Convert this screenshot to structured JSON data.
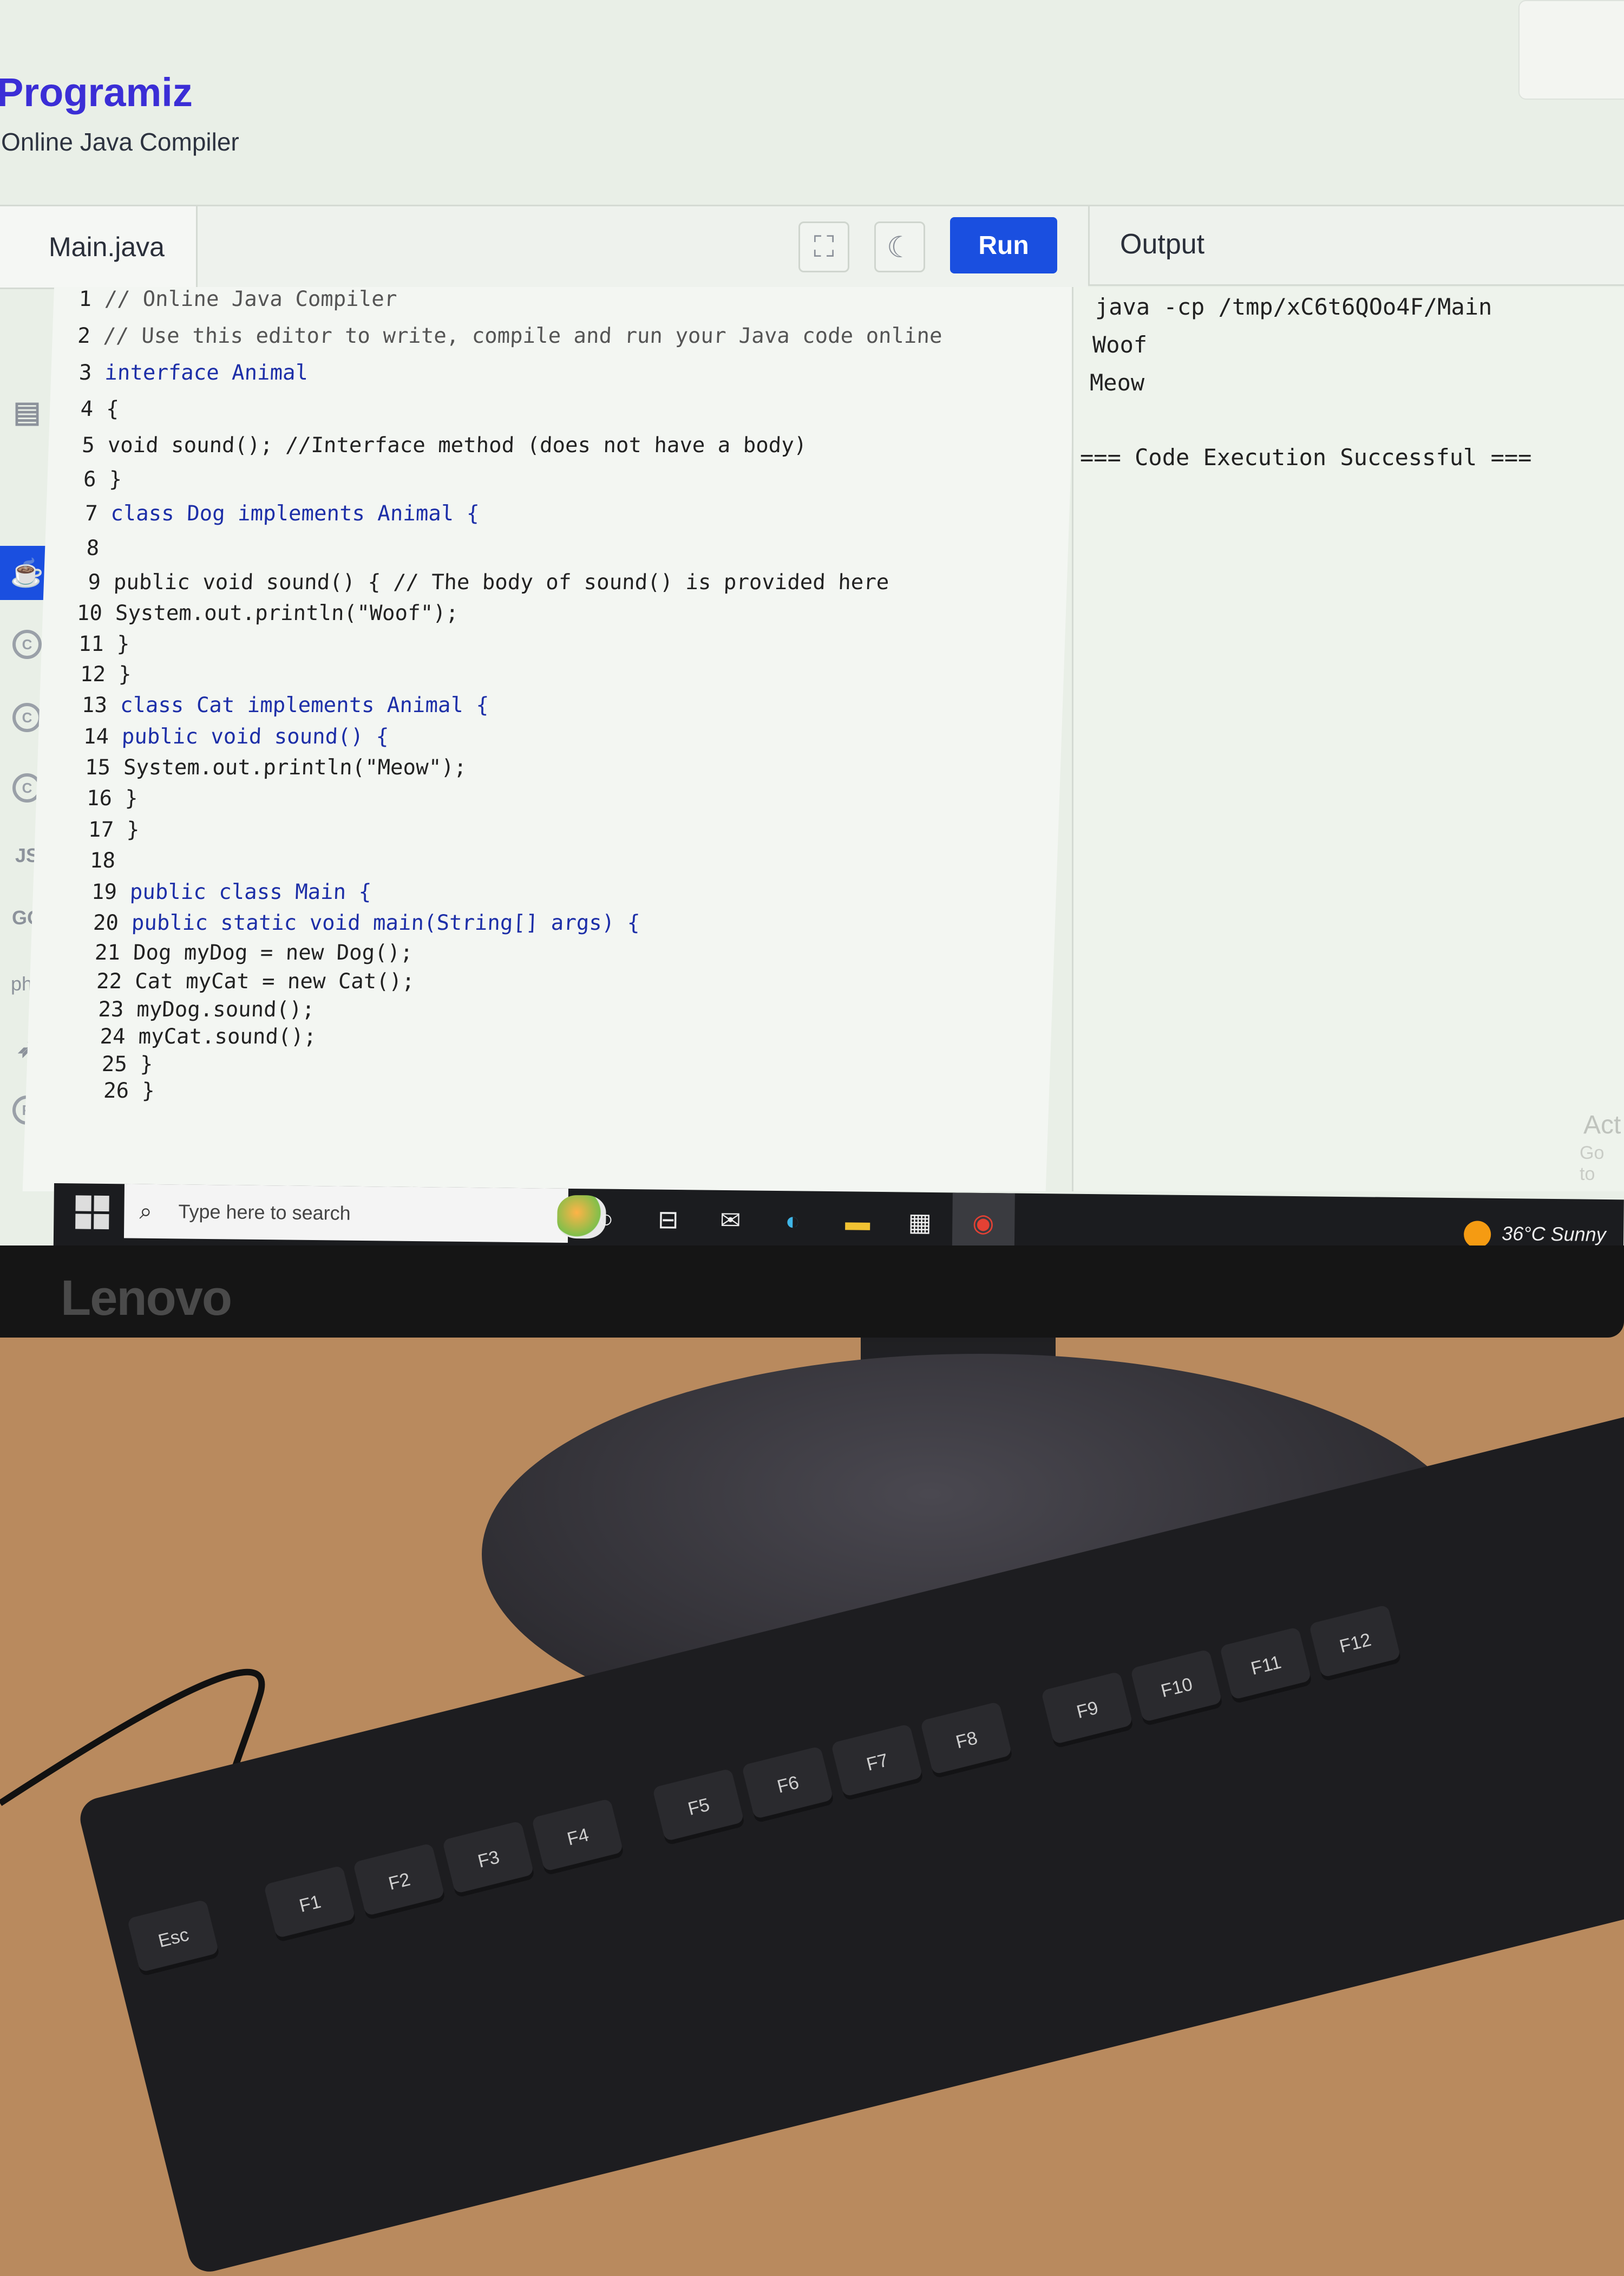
{
  "page": {
    "logo": "Programiz",
    "subtitle": "Online Java Compiler"
  },
  "editor": {
    "file_tab": "Main.java",
    "run_label": "Run",
    "fullscreen_icon": "fullscreen-icon",
    "theme_icon": "moon-icon"
  },
  "output": {
    "title": "Output",
    "lines": [
      "java -cp /tmp/xC6t6QOo4F/Main",
      "Woof",
      "Meow",
      "",
      "=== Code Execution Successful ==="
    ]
  },
  "languages": [
    {
      "label": "",
      "icon": "python-icon"
    },
    {
      "label": "",
      "icon": "sql-icon"
    },
    {
      "label": "",
      "icon": "java-icon",
      "active": true
    },
    {
      "label": "C",
      "icon": "c-icon"
    },
    {
      "label": "C++",
      "icon": "cpp-icon"
    },
    {
      "label": "C#",
      "icon": "csharp-icon"
    },
    {
      "label": "JS",
      "icon": "javascript-icon"
    },
    {
      "label": "GO",
      "icon": "go-icon"
    },
    {
      "label": "php",
      "icon": "php-icon"
    },
    {
      "label": "",
      "icon": "swift-icon"
    },
    {
      "label": "R",
      "icon": "r-icon"
    }
  ],
  "code": {
    "line_numbers": [
      "1",
      "2",
      "3",
      "4",
      "5",
      "6",
      "7",
      "8",
      "9",
      "10",
      "11",
      "12",
      "13",
      "14",
      "15",
      "16",
      "17",
      "18",
      "19",
      "20",
      "21",
      "22",
      "23",
      "24",
      "25",
      "26"
    ],
    "lines": [
      "// Online Java Compiler",
      "// Use this editor to write, compile and run your Java code online",
      "interface Animal",
      "{",
      "void sound(); //Interface method (does not have a body)",
      "}",
      "class Dog implements Animal {",
      "",
      "public void sound() { // The body of sound() is provided here",
      "System.out.println(\"Woof\");",
      "}",
      "}",
      "class Cat implements Animal {",
      "public void sound() {",
      "System.out.println(\"Meow\");",
      "}",
      "}",
      "",
      "public class Main {",
      "public static void main(String[] args) {",
      "Dog myDog = new Dog();",
      "Cat myCat = new Cat();",
      "myDog.sound();",
      "myCat.sound();",
      "}",
      "}"
    ]
  },
  "watermark": {
    "line1": "Act",
    "line2": "Go to"
  },
  "taskbar": {
    "search_placeholder": "Type here to search",
    "weather": "36°C  Sunny",
    "icons": [
      "cortana-icon",
      "task-view-icon",
      "mail-icon",
      "edge-icon",
      "file-explorer-icon",
      "store-icon",
      "chrome-icon"
    ]
  },
  "hardware": {
    "monitor_brand": "Lenovo",
    "keyboard_keys": [
      "Esc",
      "F1",
      "F2",
      "F3",
      "F4",
      "F5",
      "F6",
      "F7",
      "F8",
      "F9",
      "F10",
      "F11",
      "F12"
    ]
  }
}
